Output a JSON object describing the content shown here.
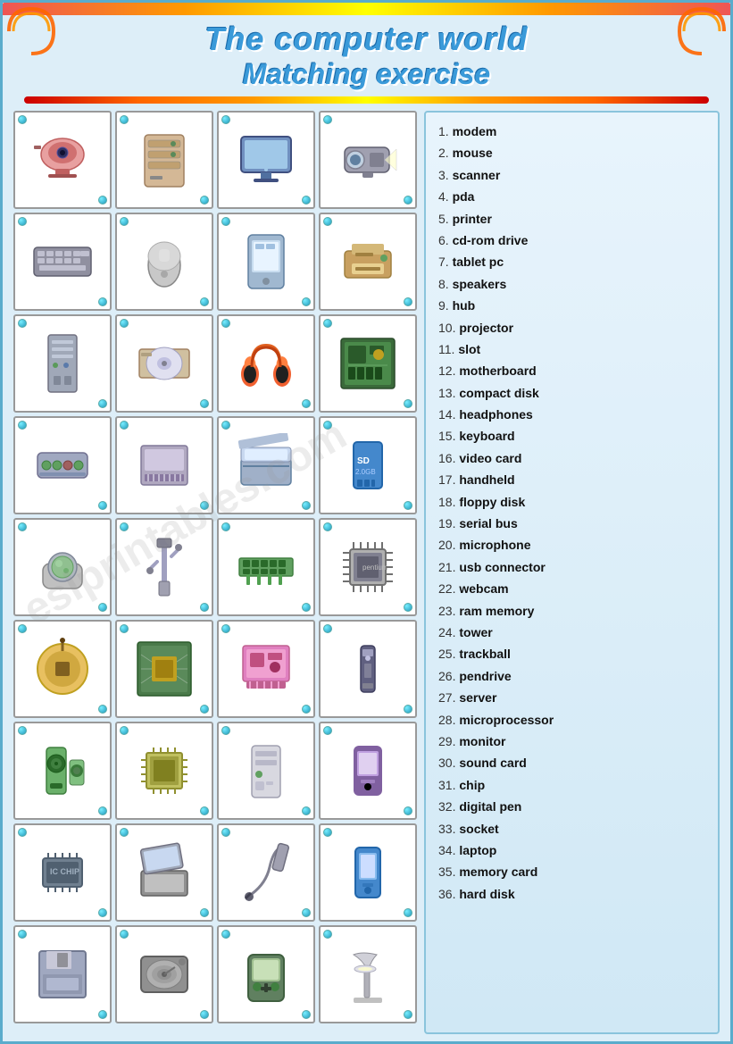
{
  "title": {
    "line1": "The computer world",
    "line2": "Matching exercise"
  },
  "words": [
    {
      "num": "1.",
      "word": "modem"
    },
    {
      "num": "2.",
      "word": "mouse"
    },
    {
      "num": "3.",
      "word": "scanner"
    },
    {
      "num": "4.",
      "word": "pda"
    },
    {
      "num": "5.",
      "word": "printer"
    },
    {
      "num": "6.",
      "word": "cd-rom drive"
    },
    {
      "num": "7.",
      "word": "tablet pc"
    },
    {
      "num": "8.",
      "word": "speakers"
    },
    {
      "num": "9.",
      "word": "hub"
    },
    {
      "num": "10.",
      "word": "projector"
    },
    {
      "num": "11.",
      "word": "slot"
    },
    {
      "num": "12.",
      "word": "motherboard"
    },
    {
      "num": "13.",
      "word": "compact disk"
    },
    {
      "num": "14.",
      "word": "headphones"
    },
    {
      "num": "15.",
      "word": "keyboard"
    },
    {
      "num": "16.",
      "word": "video card"
    },
    {
      "num": "17.",
      "word": "handheld"
    },
    {
      "num": "18.",
      "word": "floppy disk"
    },
    {
      "num": "19.",
      "word": "serial bus"
    },
    {
      "num": "20.",
      "word": "microphone"
    },
    {
      "num": "21.",
      "word": "usb connector"
    },
    {
      "num": "22.",
      "word": "webcam"
    },
    {
      "num": "23.",
      "word": "ram memory"
    },
    {
      "num": "24.",
      "word": "tower"
    },
    {
      "num": "25.",
      "word": "trackball"
    },
    {
      "num": "26.",
      "word": "pendrive"
    },
    {
      "num": "27.",
      "word": "server"
    },
    {
      "num": "28.",
      "word": "microprocessor"
    },
    {
      "num": "29.",
      "word": "monitor"
    },
    {
      "num": "30.",
      "word": "sound card"
    },
    {
      "num": "31.",
      "word": "chip"
    },
    {
      "num": "32.",
      "word": "digital pen"
    },
    {
      "num": "33.",
      "word": "socket"
    },
    {
      "num": "34.",
      "word": "laptop"
    },
    {
      "num": "35.",
      "word": "memory card"
    },
    {
      "num": "36.",
      "word": "hard disk"
    }
  ],
  "grid_cells": [
    "webcam",
    "server",
    "monitor",
    "projector",
    "keyboard",
    "mouse",
    "pda",
    "printer",
    "tower",
    "cd-rom",
    "headphones",
    "motherboard",
    "hub",
    "slot",
    "scanner",
    "memory-card",
    "trackball",
    "usb",
    "ram",
    "microprocessor",
    "power",
    "circuit",
    "sound-card",
    "pendrive",
    "speakers",
    "microchip",
    "desktop",
    "handheld2",
    "chip",
    "laptop-open",
    "digital-pen",
    "pda2",
    "floppy",
    "hard-disk",
    "handheld3",
    "desk-lamp"
  ]
}
